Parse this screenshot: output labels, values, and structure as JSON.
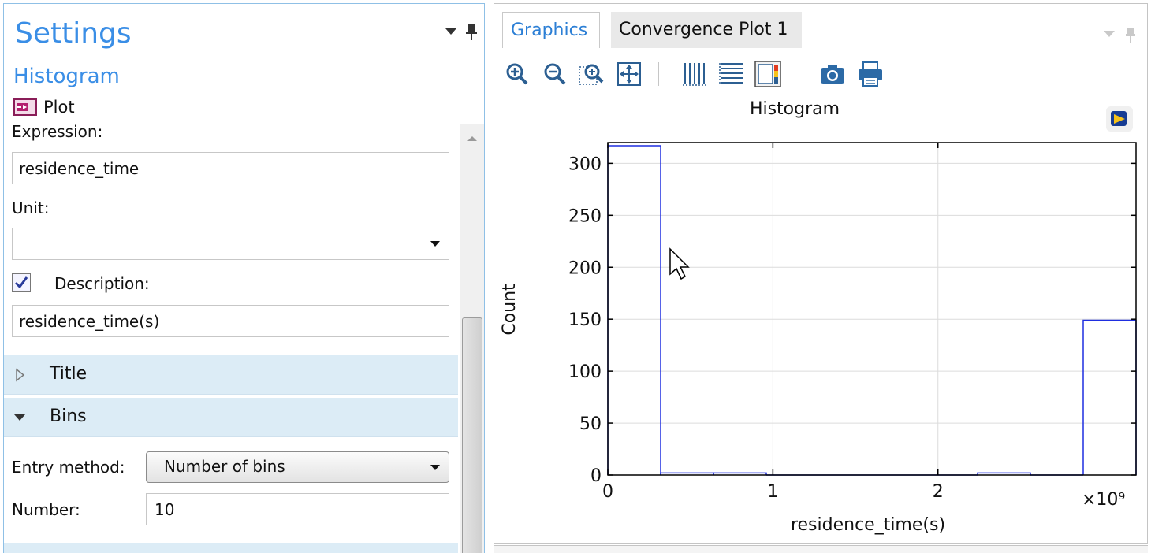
{
  "settings": {
    "title": "Settings",
    "subtitle": "Histogram",
    "plot_label": "Plot",
    "expression_label": "Expression:",
    "expression_value": "residence_time",
    "unit_label": "Unit:",
    "unit_value": "",
    "description_label": "Description:",
    "description_checked": true,
    "description_value": "residence_time(s)",
    "sections": [
      {
        "label": "Title",
        "expanded": false
      },
      {
        "label": "Bins",
        "expanded": true
      }
    ],
    "entry_method_label": "Entry method:",
    "entry_method_value": "Number of bins",
    "number_label": "Number:",
    "number_value": "10"
  },
  "graphics": {
    "tabs": [
      {
        "label": "Graphics",
        "active": true
      },
      {
        "label": "Convergence Plot 1",
        "active": false
      }
    ],
    "toolbar": [
      "zoom-in",
      "zoom-out",
      "zoom-box",
      "zoom-extents",
      "x-grid",
      "y-grid",
      "legend",
      "image-snapshot",
      "print"
    ]
  },
  "chart_data": {
    "type": "histogram",
    "title": "Histogram",
    "xlabel": "residence_time(s)",
    "ylabel": "Count",
    "x_multiplier": "×10⁹",
    "xlim": [
      0,
      3.2
    ],
    "ylim": [
      0,
      320
    ],
    "x_ticks": [
      0,
      1,
      2
    ],
    "y_ticks": [
      0,
      50,
      100,
      150,
      200,
      250,
      300
    ],
    "grid": true,
    "line_color": "#1f2ee0",
    "bin_edges": [
      0,
      0.32,
      0.64,
      0.96,
      1.28,
      1.6,
      1.92,
      2.24,
      2.56,
      2.88,
      3.2
    ],
    "counts": [
      317,
      2,
      2,
      0,
      0,
      0,
      0,
      2,
      0,
      149
    ]
  }
}
